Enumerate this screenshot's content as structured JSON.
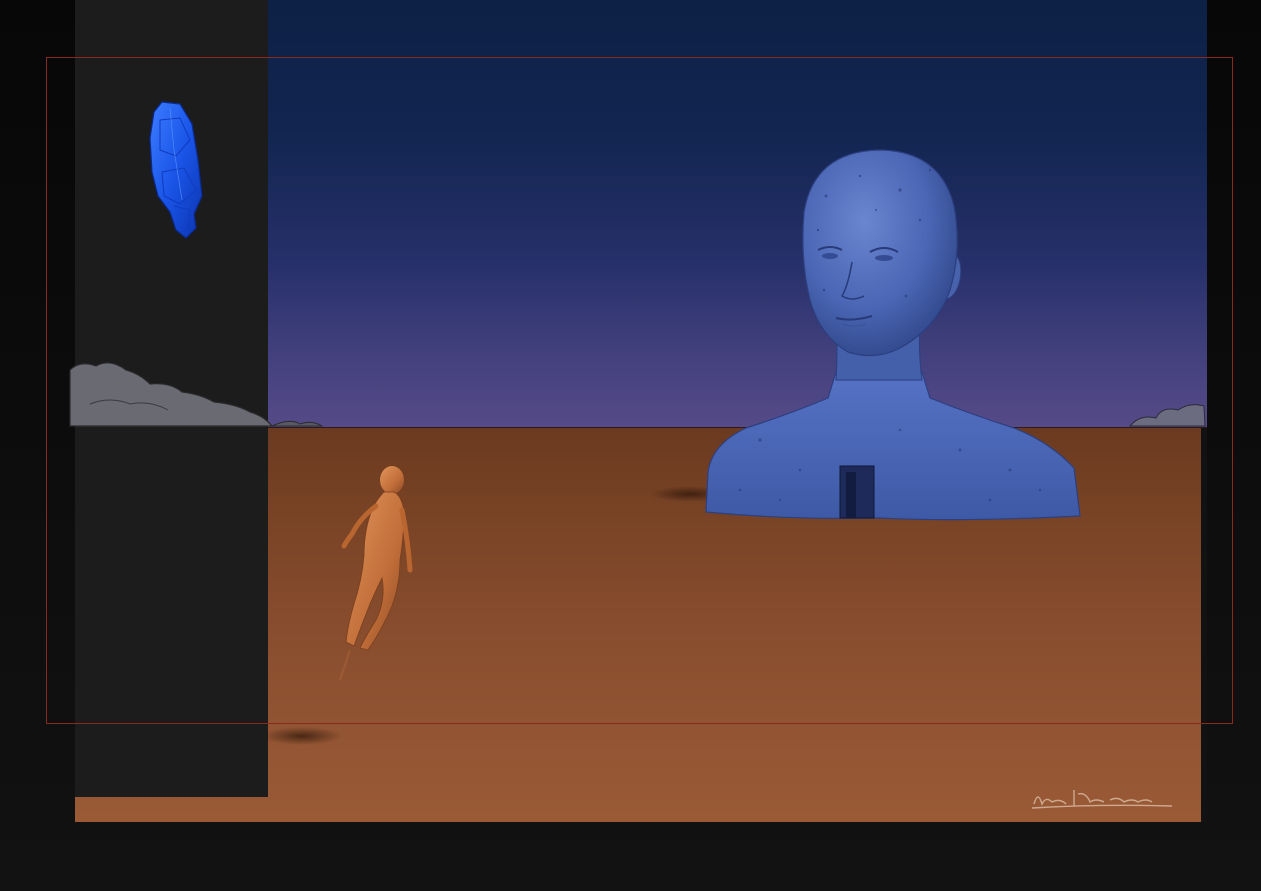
{
  "scene": {
    "sky_color_top": "#0d2146",
    "sky_color_horizon": "#564a88",
    "ground_color": "#8c5030",
    "statue_color": "#4a6bc0",
    "crystal_color": "#1a5cf0",
    "figure_color": "#c4743e",
    "crop_guide_color": "#8a2a1a"
  },
  "icons": {
    "statue": "stone-head-bust",
    "crystal": "floating-blue-crystal",
    "figure": "floating-human-figure",
    "signature": "artist-signature"
  }
}
